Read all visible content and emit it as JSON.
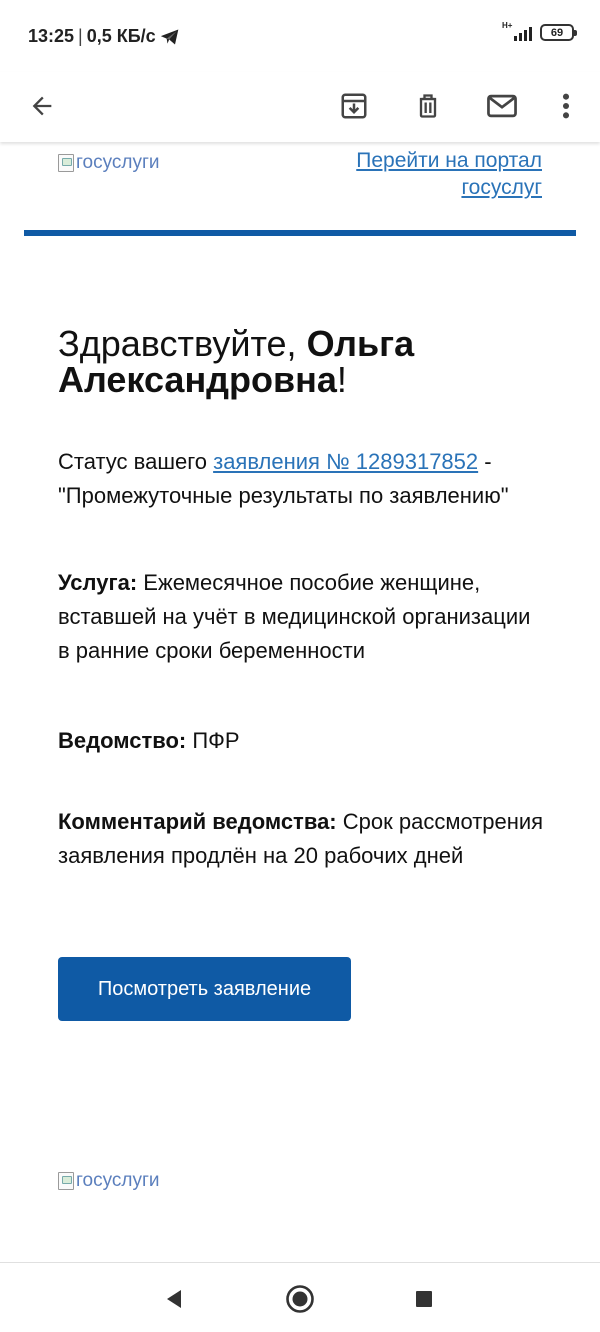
{
  "status_bar": {
    "time": "13:25",
    "speed": "0,5 КБ/с",
    "network": "H+",
    "battery": "69"
  },
  "toolbar": {
    "back_icon": "arrow-back-icon",
    "archive_icon": "archive-icon",
    "delete_icon": "trash-icon",
    "unread_icon": "mail-icon",
    "more_icon": "more-vert-icon"
  },
  "email": {
    "logo_alt_top": "госуслуги",
    "portal_link_line1": "Перейти на портал",
    "portal_link_line2": "госуслуг",
    "greeting_prefix": "Здравствуйте, ",
    "greeting_name": "Ольга Александровна",
    "greeting_suffix": "!",
    "status_prefix": "Статус вашего ",
    "status_link": "заявления № 1289317852",
    "status_suffix": " - \"Промежуточные результаты по заявлению\"",
    "service_label": "Услуга:",
    "service_value": " Ежемесячное пособие женщине, вставшей на учёт в медицинской организации в ранние сроки беременности",
    "department_label": "Ведомство:",
    "department_value": " ПФР",
    "comment_label": "Комментарий ведомства:",
    "comment_value": " Срок рассмотрения заявления продлён на 20 рабочих дней",
    "view_button": "Посмотреть заявление",
    "logo_alt_bottom": "госуслуги"
  },
  "colors": {
    "brand_blue": "#0f5aa5",
    "link_blue": "#2a73b8"
  }
}
